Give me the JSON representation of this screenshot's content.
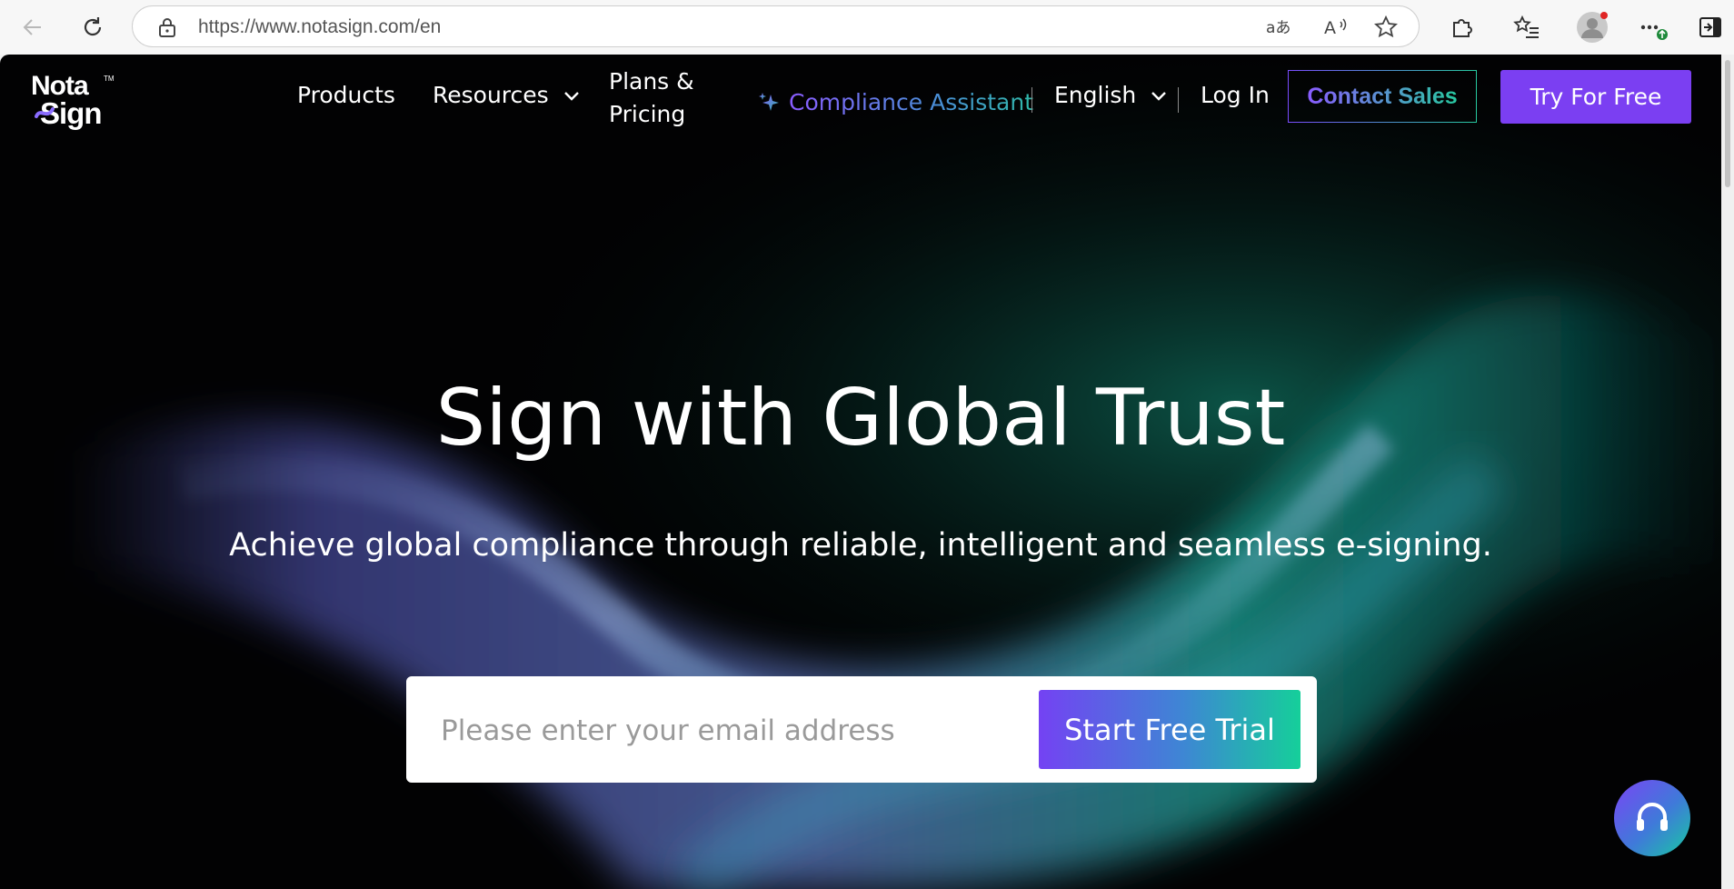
{
  "browser": {
    "url": "https://www.notasign.com/en",
    "back_icon": "arrow-left-icon",
    "reload_icon": "reload-icon",
    "lock_icon": "lock-icon",
    "translate_icon": "translate-icon",
    "read_aloud_icon": "read-aloud-icon",
    "favorite_icon": "star-icon",
    "extensions_icon": "puzzle-icon",
    "favorites_icon": "favorites-list-icon",
    "profile_icon": "avatar-icon",
    "more_icon": "more-dots-icon",
    "sidebar_icon": "sidebar-toggle-icon"
  },
  "header": {
    "logo_top": "Nota",
    "logo_bottom": "Sign",
    "logo_tm": "TM",
    "nav": {
      "products": "Products",
      "resources": "Resources",
      "plans_line1": "Plans &",
      "plans_line2": "Pricing"
    },
    "compliance_assistant": "Compliance Assistant",
    "language": "English",
    "login": "Log In",
    "contact_sales": "Contact Sales",
    "try_free": "Try For Free"
  },
  "hero": {
    "title": "Sign with Global Trust",
    "subtitle": "Achieve global compliance through reliable, intelligent and seamless e-signing.",
    "email_placeholder": "Please enter your email address",
    "cta": "Start Free Trial"
  },
  "support_icon": "headset-icon",
  "colors": {
    "accent_purple": "#7b3ff2",
    "accent_teal": "#15cf9a",
    "page_bg": "#020203"
  }
}
